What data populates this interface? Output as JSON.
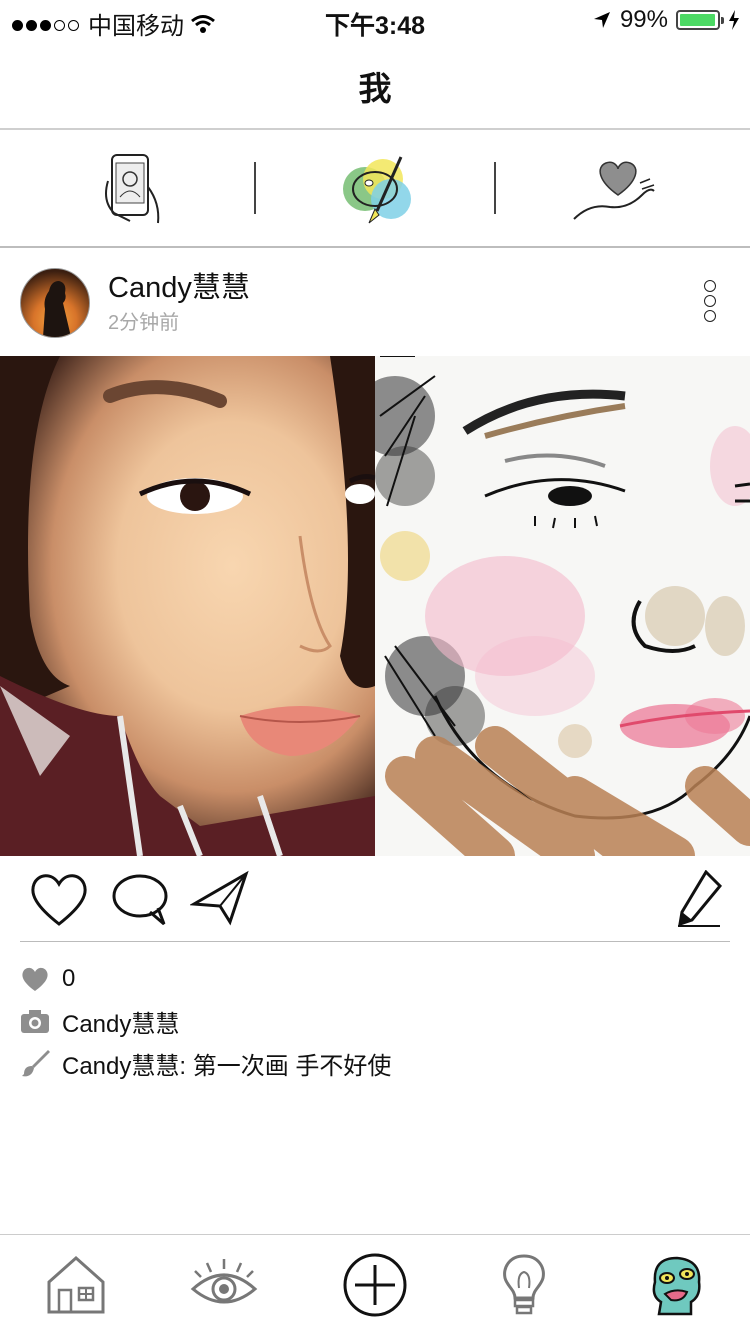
{
  "status_bar": {
    "carrier": "中国移动",
    "time": "下午3:48",
    "battery": "99%",
    "battery_level": 0.99
  },
  "nav": {
    "title": "我"
  },
  "segments": [
    {
      "icon": "phone-drawing-icon"
    },
    {
      "icon": "palette-icon"
    },
    {
      "icon": "heart-hand-icon"
    }
  ],
  "post": {
    "username": "Candy慧慧",
    "time": "2分钟前",
    "likes_count": "0",
    "photographer": "Candy慧慧",
    "caption": "Candy慧慧: 第一次画 手不好使"
  },
  "tabbar": [
    {
      "icon": "home-icon"
    },
    {
      "icon": "eye-icon"
    },
    {
      "icon": "add-icon"
    },
    {
      "icon": "lightbulb-icon"
    },
    {
      "icon": "profile-monster-icon"
    }
  ],
  "colors": {
    "battery_fill": "#4cd964",
    "gray_icon": "#8e8e8e",
    "divider": "#cfcfcf"
  }
}
